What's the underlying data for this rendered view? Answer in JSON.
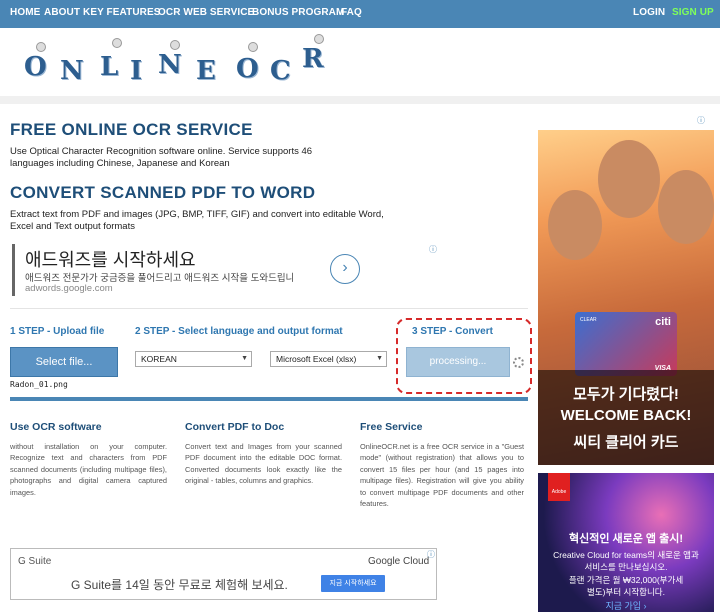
{
  "nav": {
    "items": [
      "HOME",
      "ABOUT",
      "KEY FEATURES",
      "OCR WEB SERVICE",
      "BONUS PROGRAM",
      "FAQ"
    ],
    "login": "LOGIN",
    "signup": "SIGN UP"
  },
  "logo": {
    "letters": [
      "O",
      "N",
      "L",
      "I",
      "N",
      "E",
      "O",
      "C",
      "R"
    ]
  },
  "section1": {
    "title": "FREE ONLINE OCR SERVICE",
    "text": "Use Optical Character Recognition software online. Service supports 46 languages including Chinese, Japanese and Korean"
  },
  "section2": {
    "title": "CONVERT SCANNED PDF TO WORD",
    "text": "Extract text from PDF and images (JPG, BMP, TIFF, GIF) and convert into editable Word, Excel and Text output formats"
  },
  "ad_top": {
    "headline": "애드워즈를 시작하세요",
    "body": "애드워즈 전문가가 궁금증을 풀어드리고 애드워즈 시작을 도와드립니",
    "url": "adwords.google.com"
  },
  "steps": {
    "step1": "1 STEP - Upload file",
    "step2": "2 STEP - Select language and output format",
    "step3": "3 STEP - Convert",
    "select_button": "Select file...",
    "file_name": "Radon_01.png",
    "language": "KOREAN",
    "format": "Microsoft Excel (xlsx)",
    "processing": "processing..."
  },
  "columns": [
    {
      "title": "Use OCR software",
      "text": "without installation on your computer. Recognize text and characters from PDF scanned documents (including multipage files), photographs and digital camera captured images."
    },
    {
      "title": "Convert PDF to Doc",
      "text": "Convert text and Images from your scanned PDF document into the editable DOC format. Converted documents look exactly like the original - tables, columns and graphics."
    },
    {
      "title": "Free Service",
      "text": "OnlineOCR.net is a free OCR service in a \"Guest mode\" (without registration) that allows you to convert 15 files per hour (and 15 pages into multipage files). Registration will give you ability to convert multipage PDF documents and other features."
    }
  ],
  "ad_bottom": {
    "brand": "G Suite",
    "cloud": "Google Cloud",
    "message": "G Suite를 14일 동안 무료로 체험해 보세요.",
    "cta": "지금 시작하세요"
  },
  "side_ad1": {
    "card_brand": "citi",
    "card_label": "CLEAR",
    "card_network": "VISA",
    "line1": "모두가 기다렸다!",
    "line2": "WELCOME BACK!",
    "line3": "씨티 클리어 카드"
  },
  "side_ad2": {
    "logo": "Adobe",
    "headline": "혁신적인 새로운 앱 출시!",
    "line1": "Creative Cloud for teams의 새로운 앱과",
    "line2": "서비스를 만나보십시오.",
    "line3": "플랜 가격은 월 ₩32,000(부가세",
    "line4": "별도)부터 시작합니다.",
    "link": "지금 가입 ›"
  },
  "colors": {
    "nav": "#4a86b5",
    "title": "#1e4e78",
    "step": "#2f77b0",
    "dashed": "#d62a2a",
    "signup": "#7fff5a"
  }
}
